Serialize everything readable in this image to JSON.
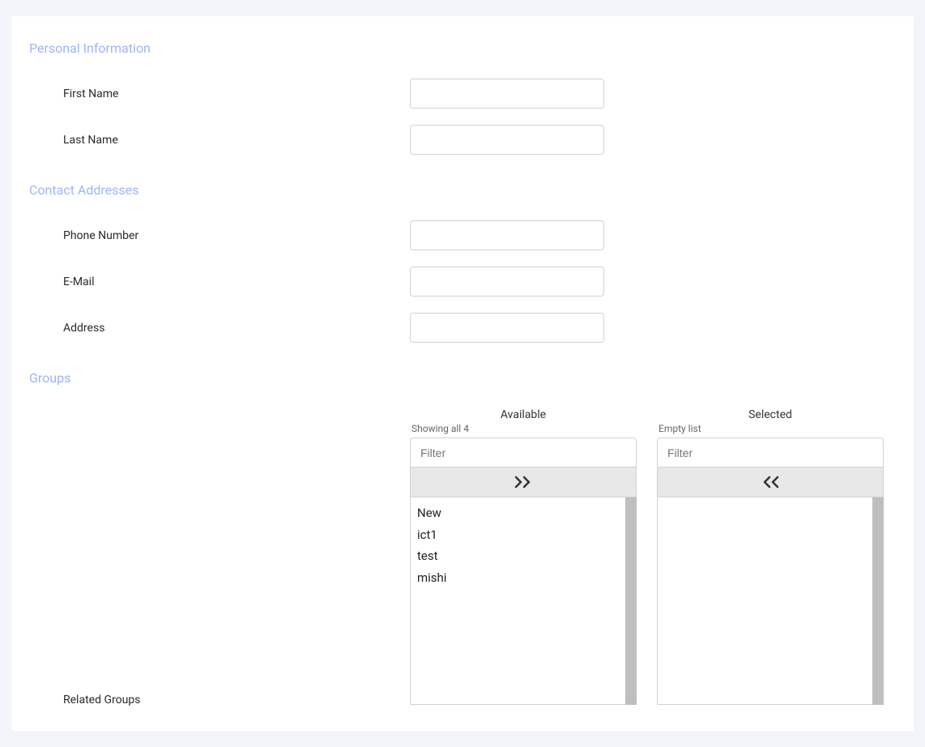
{
  "sections": {
    "personal": {
      "title": "Personal Information",
      "fields": {
        "first_name": {
          "label": "First Name",
          "value": ""
        },
        "last_name": {
          "label": "Last Name",
          "value": ""
        }
      }
    },
    "contact": {
      "title": "Contact Addresses",
      "fields": {
        "phone": {
          "label": "Phone Number",
          "value": ""
        },
        "email": {
          "label": "E-Mail",
          "value": ""
        },
        "address": {
          "label": "Address",
          "value": ""
        }
      }
    },
    "groups": {
      "title": "Groups",
      "related_label": "Related Groups",
      "available": {
        "title": "Available",
        "status": "Showing all 4",
        "filter_placeholder": "Filter",
        "items": [
          "New",
          "ict1",
          "test",
          "mishi"
        ]
      },
      "selected": {
        "title": "Selected",
        "status": "Empty list",
        "filter_placeholder": "Filter",
        "items": []
      }
    }
  }
}
